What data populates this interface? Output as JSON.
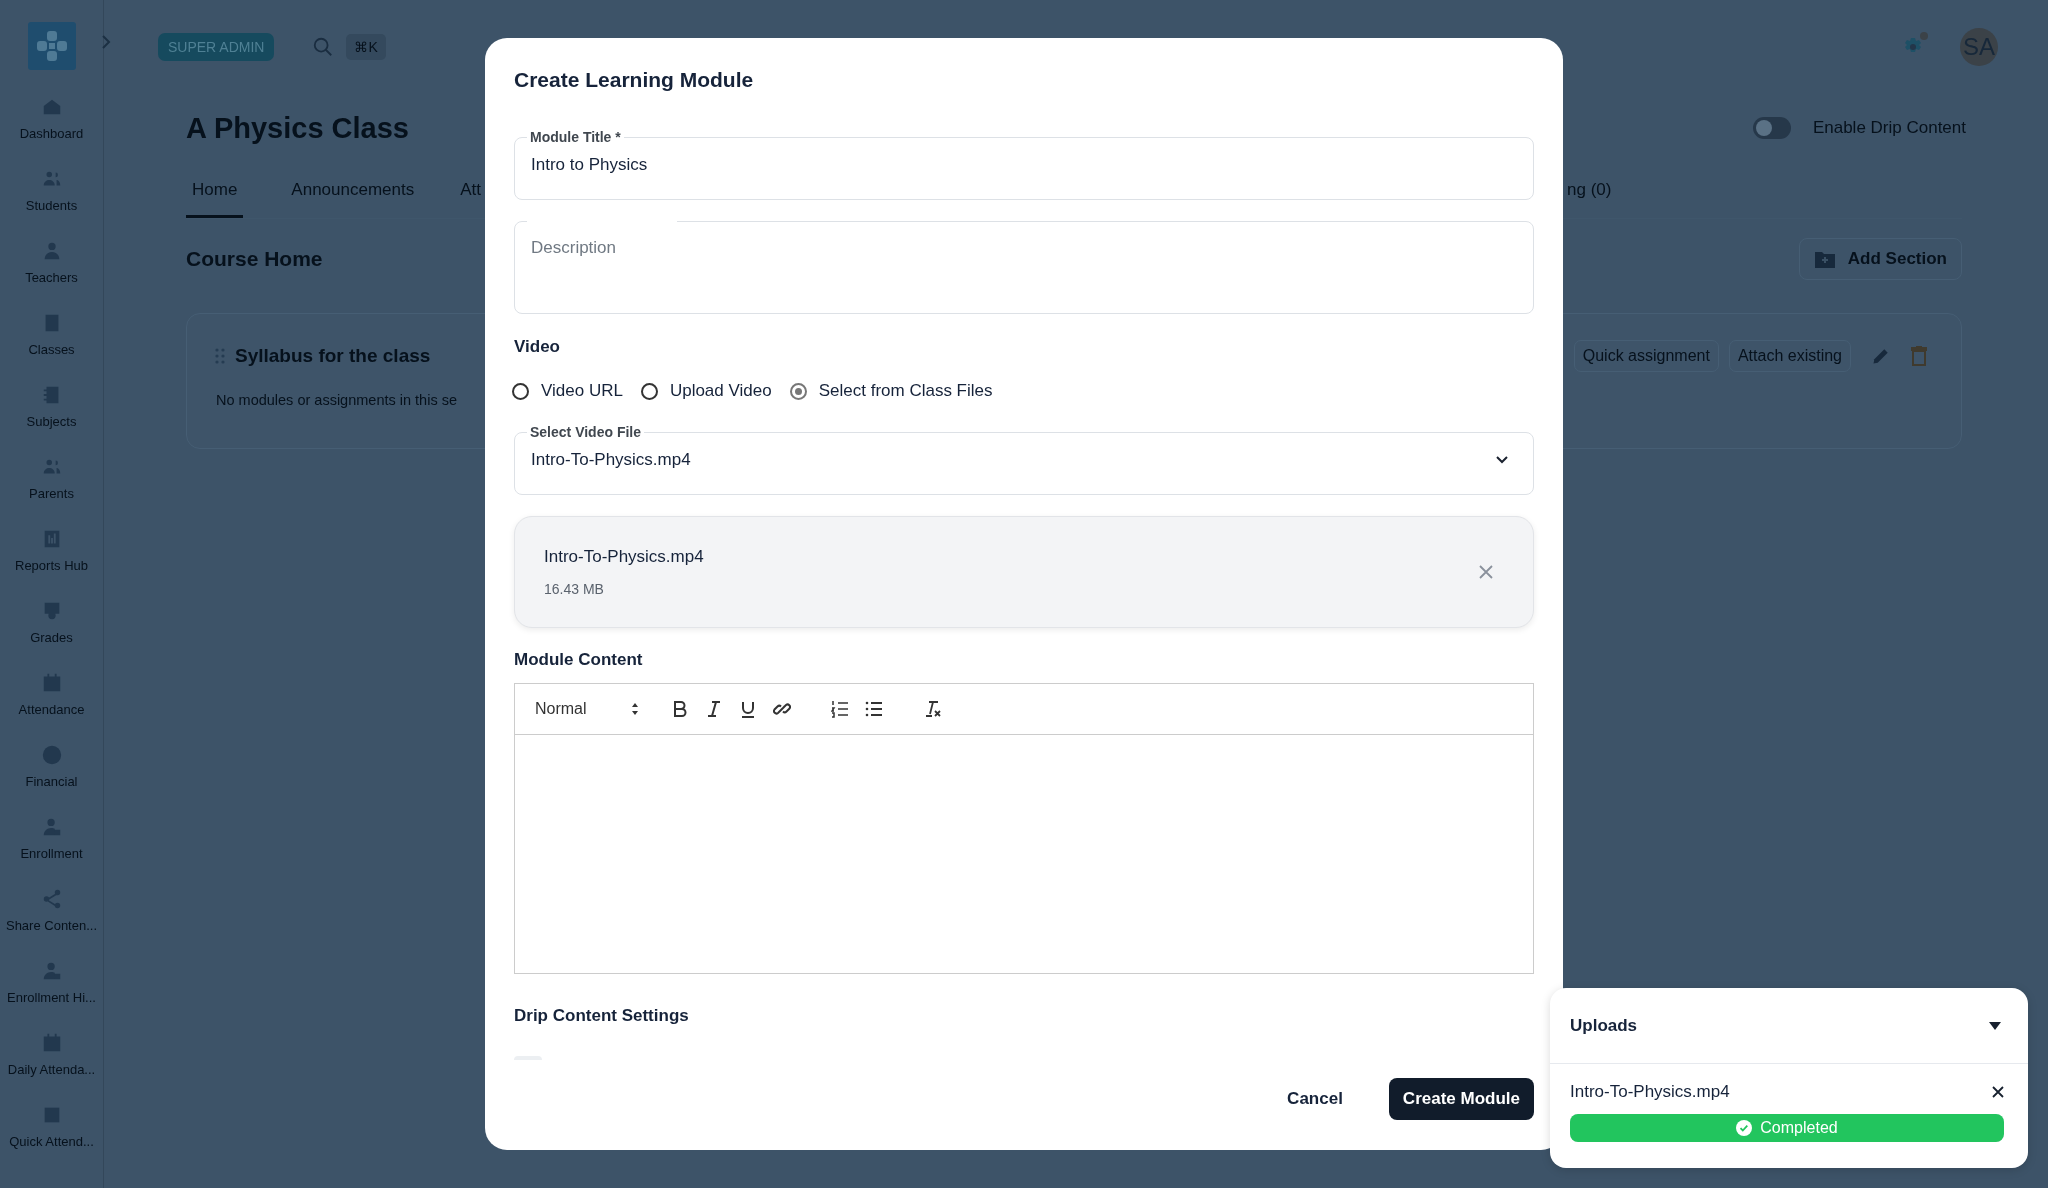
{
  "sidebar": {
    "items": [
      {
        "label": "Dashboard"
      },
      {
        "label": "Students"
      },
      {
        "label": "Teachers"
      },
      {
        "label": "Classes"
      },
      {
        "label": "Subjects"
      },
      {
        "label": "Parents"
      },
      {
        "label": "Reports Hub"
      },
      {
        "label": "Grades"
      },
      {
        "label": "Attendance"
      },
      {
        "label": "Financial"
      },
      {
        "label": "Enrollment"
      },
      {
        "label": "Share Conten..."
      },
      {
        "label": "Enrollment Hi..."
      },
      {
        "label": "Daily Attenda..."
      },
      {
        "label": "Quick Attend..."
      }
    ]
  },
  "header": {
    "role_badge": "SUPER ADMIN",
    "search_shortcut": "⌘K",
    "avatar": "SA"
  },
  "page": {
    "title": "A Physics Class",
    "drip_toggle": {
      "label": "Enable Drip Content",
      "on": false
    },
    "tabs": [
      {
        "label": "Home",
        "selected": true
      },
      {
        "label": "Announcements",
        "selected": false
      },
      {
        "label": "Att",
        "selected": false
      },
      {
        "label": "ng (0)",
        "selected": false
      }
    ],
    "section_heading": "Course Home",
    "add_section": "Add Section",
    "section": {
      "title": "Syllabus for the class",
      "empty_text": "No modules or assignments in this se",
      "actions": [
        "Quick assignment",
        "Attach existing"
      ]
    }
  },
  "modal": {
    "title": "Create Learning Module",
    "module_title": {
      "label": "Module Title *",
      "value": "Intro to Physics"
    },
    "description": {
      "placeholder": "Description"
    },
    "video_heading": "Video",
    "video_options": [
      {
        "label": "Video URL",
        "selected": false
      },
      {
        "label": "Upload Video",
        "selected": false
      },
      {
        "label": "Select from Class Files",
        "selected": true
      }
    ],
    "video_file": {
      "label": "Select Video File",
      "value": "Intro-To-Physics.mp4"
    },
    "file_card": {
      "name": "Intro-To-Physics.mp4",
      "size": "16.43 MB"
    },
    "content_heading": "Module Content",
    "editor": {
      "heading_style": "Normal"
    },
    "drip_heading": "Drip Content Settings",
    "buttons": {
      "cancel": "Cancel",
      "submit": "Create Module"
    }
  },
  "uploads": {
    "title": "Uploads",
    "items": [
      {
        "name": "Intro-To-Physics.mp4",
        "status": "Completed",
        "level": 1
      }
    ]
  }
}
